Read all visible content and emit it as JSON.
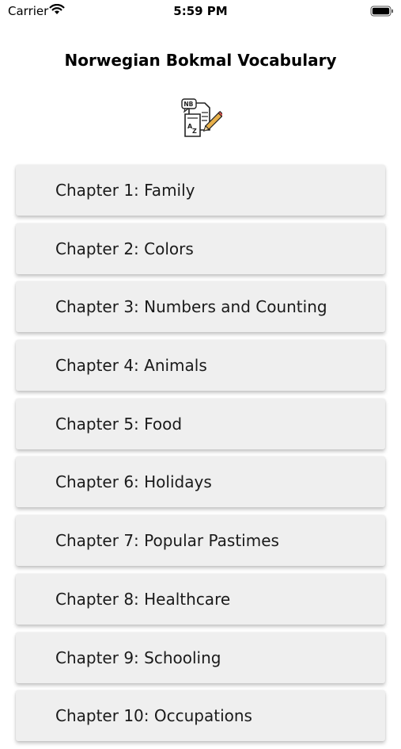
{
  "status_bar": {
    "carrier": "Carrier",
    "time": "5:59 PM"
  },
  "header": {
    "title": "Norwegian Bokmal Vocabulary",
    "logo_badge": "NB",
    "logo_icon": "document-pencil-icon"
  },
  "chapters": [
    {
      "label": "Chapter 1: Family"
    },
    {
      "label": "Chapter 2: Colors"
    },
    {
      "label": "Chapter 3: Numbers and Counting"
    },
    {
      "label": "Chapter 4: Animals"
    },
    {
      "label": "Chapter 5: Food"
    },
    {
      "label": "Chapter 6: Holidays"
    },
    {
      "label": "Chapter 7: Popular Pastimes"
    },
    {
      "label": "Chapter 8: Healthcare"
    },
    {
      "label": "Chapter 9: Schooling"
    },
    {
      "label": "Chapter 10: Occupations"
    }
  ],
  "colors": {
    "row_background": "#efefef",
    "page_background": "#ffffff"
  }
}
